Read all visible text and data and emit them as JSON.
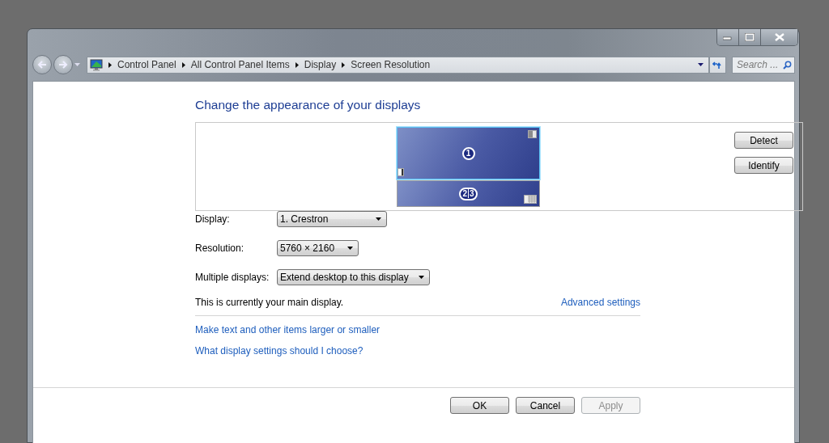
{
  "address_bar": {
    "breadcrumbs": [
      "Control Panel",
      "All Control Panel Items",
      "Display",
      "Screen Resolution"
    ]
  },
  "search": {
    "placeholder": "Search ..."
  },
  "heading": "Change the appearance of your displays",
  "monitors": [
    {
      "kind": "single",
      "labels": [
        "1"
      ],
      "selected": true
    },
    {
      "kind": "duplicate",
      "labels": [
        "2",
        "3"
      ],
      "selected": false
    }
  ],
  "preview_buttons": [
    "Detect",
    "Identify"
  ],
  "settings": [
    {
      "label": "Display:",
      "value": "1. Crestron"
    },
    {
      "label": "Resolution:",
      "value": "5760 × 2160"
    },
    {
      "label": "Multiple displays:",
      "value": "Extend desktop to this display"
    }
  ],
  "status_text": "This is currently your main display.",
  "advanced_link": "Advanced settings",
  "links": [
    "Make text and other items larger or smaller",
    "What display settings should I choose?"
  ],
  "buttons": [
    {
      "label": "OK",
      "disabled": false
    },
    {
      "label": "Cancel",
      "disabled": false
    },
    {
      "label": "Apply",
      "disabled": true
    }
  ]
}
